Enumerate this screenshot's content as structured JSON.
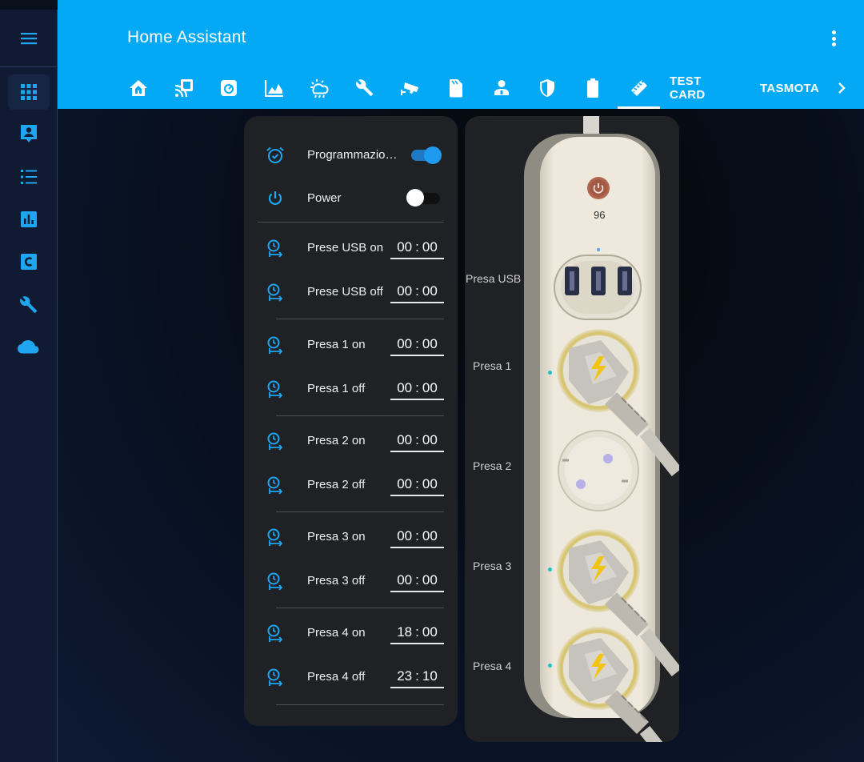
{
  "app": {
    "title": "Home Assistant"
  },
  "header": {
    "tabs": [
      {
        "name": "home-icon"
      },
      {
        "name": "rss-icon"
      },
      {
        "name": "gauge-icon"
      },
      {
        "name": "chart-area-icon"
      },
      {
        "name": "weather-icon"
      },
      {
        "name": "wrench-icon"
      },
      {
        "name": "cctv-icon"
      },
      {
        "name": "sim-icon"
      },
      {
        "name": "account-icon"
      },
      {
        "name": "shield-icon"
      },
      {
        "name": "battery-icon"
      },
      {
        "name": "ruler-icon",
        "active": true
      },
      {
        "label": "TEST CARD"
      },
      {
        "label": "TASMOTA"
      }
    ]
  },
  "sidebar": {
    "items": [
      {
        "name": "grid-icon",
        "active": true
      },
      {
        "name": "account-box-icon"
      },
      {
        "name": "format-list-icon"
      },
      {
        "name": "chart-box-icon"
      },
      {
        "name": "letter-c-icon"
      },
      {
        "name": "wrench-icon"
      },
      {
        "name": "cloud-icon"
      }
    ]
  },
  "controls": {
    "programmazione": {
      "label": "Programmazione",
      "on": true
    },
    "power": {
      "label": "Power",
      "on": false
    },
    "timers": [
      {
        "label": "Prese USB on",
        "h": "00",
        "m": "00"
      },
      {
        "label": "Prese USB off",
        "h": "00",
        "m": "00"
      },
      {
        "label": "Presa 1 on",
        "h": "00",
        "m": "00"
      },
      {
        "label": "Presa 1 off",
        "h": "00",
        "m": "00"
      },
      {
        "label": "Presa 2 on",
        "h": "00",
        "m": "00"
      },
      {
        "label": "Presa 2 off",
        "h": "00",
        "m": "00"
      },
      {
        "label": "Presa 3 on",
        "h": "00",
        "m": "00"
      },
      {
        "label": "Presa 3 off",
        "h": "00",
        "m": "00"
      },
      {
        "label": "Presa 4 on",
        "h": "18",
        "m": "00"
      },
      {
        "label": "Presa 4 off",
        "h": "23",
        "m": "10"
      }
    ]
  },
  "strip": {
    "power_value": "96",
    "labels": [
      "Presa USB",
      "Presa 1",
      "Presa 2",
      "Presa 3",
      "Presa 4"
    ],
    "colors": {
      "body": "#ece6d6",
      "accent": "#03a9f4",
      "power_button": "#b3674f"
    }
  }
}
